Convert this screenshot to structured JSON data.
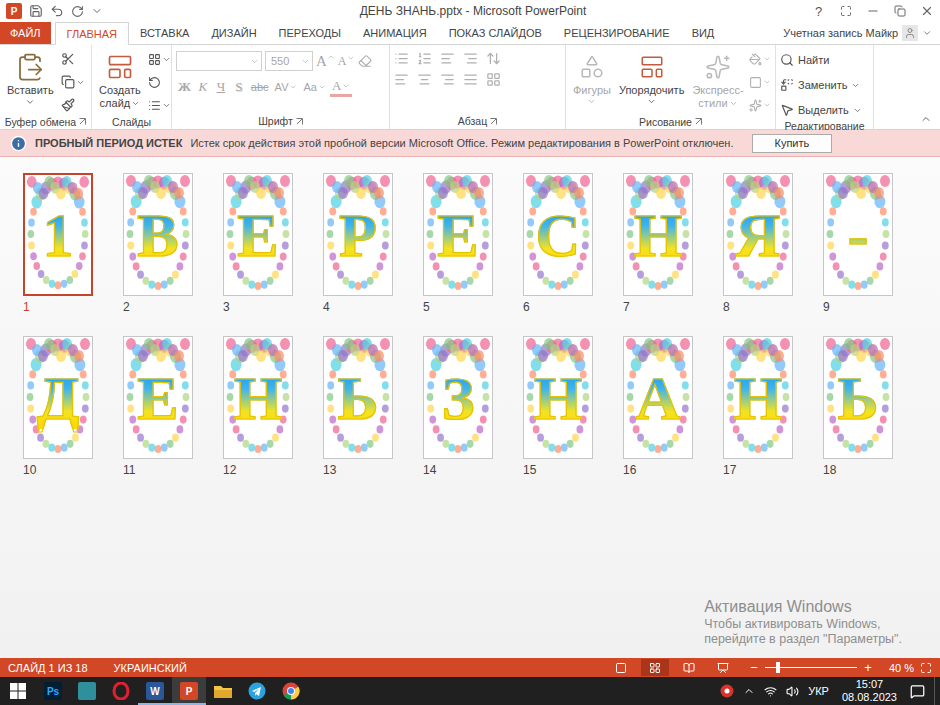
{
  "window": {
    "title": "ДЕНЬ ЗНАНЬ.pptx - Microsoft PowerPoint",
    "app_badge": "P",
    "help": "?"
  },
  "ribbon_tabs": [
    {
      "label": "ФАЙЛ",
      "selected": false,
      "kind": "file"
    },
    {
      "label": "ГЛАВНАЯ",
      "selected": true,
      "kind": "tab"
    },
    {
      "label": "ВСТАВКА",
      "selected": false,
      "kind": "tab"
    },
    {
      "label": "ДИЗАЙН",
      "selected": false,
      "kind": "tab"
    },
    {
      "label": "ПЕРЕХОДЫ",
      "selected": false,
      "kind": "tab"
    },
    {
      "label": "АНИМАЦИЯ",
      "selected": false,
      "kind": "tab"
    },
    {
      "label": "ПОКАЗ СЛАЙДОВ",
      "selected": false,
      "kind": "tab"
    },
    {
      "label": "РЕЦЕНЗИРОВАНИЕ",
      "selected": false,
      "kind": "tab"
    },
    {
      "label": "ВИД",
      "selected": false,
      "kind": "tab"
    }
  ],
  "account": "Учетная запись Майкр",
  "ribbon": {
    "clipboard": {
      "label": "Буфер обмена",
      "paste": "Вставить"
    },
    "slides": {
      "label": "Слайды",
      "new_slide": [
        "Создать",
        "слайд"
      ]
    },
    "font": {
      "label": "Шрифт",
      "size": "550",
      "disabled": true,
      "grow": "A",
      "shrink": "A",
      "format_buttons": [
        {
          "label": "Ж",
          "kind": "bold"
        },
        {
          "label": "К",
          "kind": "italic"
        },
        {
          "label": "Ч",
          "kind": "underline"
        },
        {
          "label": "S",
          "kind": "shadow"
        },
        {
          "label": "abc",
          "kind": "strike"
        },
        {
          "label": "AV",
          "kind": "spacing"
        },
        {
          "label": "Aa",
          "kind": "case"
        },
        {
          "label": "A",
          "kind": "color"
        }
      ]
    },
    "paragraph": {
      "label": "Абзац",
      "disabled": true
    },
    "drawing": {
      "label": "Рисование",
      "tools": [
        {
          "lines": [
            "Фигуры"
          ],
          "kind": "shapes",
          "disabled": true
        },
        {
          "lines": [
            "Упорядочить"
          ],
          "kind": "arrange",
          "disabled": false
        },
        {
          "lines": [
            "Экспресс-",
            "стили"
          ],
          "kind": "styles",
          "disabled": true
        }
      ]
    },
    "editing": {
      "label": "Редактирование",
      "commands": [
        {
          "label": "Найти",
          "kind": "find",
          "dropdown": false
        },
        {
          "label": "Заменить",
          "kind": "replace",
          "dropdown": true
        },
        {
          "label": "Выделить",
          "kind": "select",
          "dropdown": true
        }
      ]
    }
  },
  "message_bar": {
    "title": "ПРОБНЫЙ ПЕРИОД ИСТЕК",
    "text": "Истек срок действия этой пробной версии Microsoft Office. Режим редактирования в PowerPoint отключен.",
    "button": "Купить"
  },
  "slides": [
    {
      "number": "1",
      "letter": "1",
      "selected": true
    },
    {
      "number": "2",
      "letter": "В",
      "selected": false
    },
    {
      "number": "3",
      "letter": "Е",
      "selected": false
    },
    {
      "number": "4",
      "letter": "Р",
      "selected": false
    },
    {
      "number": "5",
      "letter": "Е",
      "selected": false
    },
    {
      "number": "6",
      "letter": "С",
      "selected": false
    },
    {
      "number": "7",
      "letter": "Н",
      "selected": false
    },
    {
      "number": "8",
      "letter": "Я",
      "selected": false
    },
    {
      "number": "9",
      "letter": "-",
      "selected": false
    },
    {
      "number": "10",
      "letter": "Д",
      "selected": false
    },
    {
      "number": "11",
      "letter": "Е",
      "selected": false
    },
    {
      "number": "12",
      "letter": "Н",
      "selected": false
    },
    {
      "number": "13",
      "letter": "Ь",
      "selected": false
    },
    {
      "number": "14",
      "letter": "З",
      "selected": false
    },
    {
      "number": "15",
      "letter": "Н",
      "selected": false
    },
    {
      "number": "16",
      "letter": "А",
      "selected": false
    },
    {
      "number": "17",
      "letter": "Н",
      "selected": false
    },
    {
      "number": "18",
      "letter": "Ь",
      "selected": false
    }
  ],
  "watermark": {
    "title": "Активация Windows",
    "lines": [
      "Чтобы активировать Windows,",
      "перейдите в раздел \"Параметры\"."
    ]
  },
  "status_bar": {
    "slide_info": "СЛАЙД 1 ИЗ 18",
    "language": "УКРАИНСКИЙ",
    "views": [
      {
        "kind": "normal",
        "selected": false
      },
      {
        "kind": "sorter",
        "selected": true
      },
      {
        "kind": "reading",
        "selected": false
      },
      {
        "kind": "show",
        "selected": false
      }
    ],
    "zoom_out": "−",
    "zoom_in": "+",
    "zoom": "40 %",
    "zoom_level": 0.14
  },
  "taskbar": {
    "apps": [
      {
        "name": "photoshop",
        "kind": "badge",
        "label": "Ps",
        "color": "#001e36",
        "text_color": "#31a8ff",
        "running": false,
        "selected": false
      },
      {
        "name": "app",
        "kind": "tile",
        "label": "",
        "color": "#2f8f9d",
        "text_color": "#ffffff",
        "running": false,
        "selected": false
      },
      {
        "name": "opera",
        "kind": "opera",
        "label": "",
        "color": "#e0202e",
        "text_color": "#ffffff",
        "running": false,
        "selected": false
      },
      {
        "name": "word",
        "kind": "badge",
        "label": "W",
        "color": "#2b579a",
        "text_color": "#ffffff",
        "running": true,
        "selected": false
      },
      {
        "name": "powerpoint",
        "kind": "badge",
        "label": "P",
        "color": "#d24726",
        "text_color": "#ffffff",
        "running": true,
        "selected": true
      },
      {
        "name": "explorer",
        "kind": "folder",
        "label": "",
        "color": "#f4c542",
        "text_color": "#ffffff",
        "running": false,
        "selected": false
      },
      {
        "name": "telegram",
        "kind": "telegram",
        "label": "",
        "color": "#2aa3de",
        "text_color": "#ffffff",
        "running": false,
        "selected": false
      },
      {
        "name": "chrome",
        "kind": "chrome",
        "label": "",
        "color": "#4285f4",
        "text_color": "#ffffff",
        "running": false,
        "selected": false
      }
    ],
    "tray": {
      "language": "УКР",
      "time": "15:07",
      "date": "08.08.2023"
    }
  }
}
